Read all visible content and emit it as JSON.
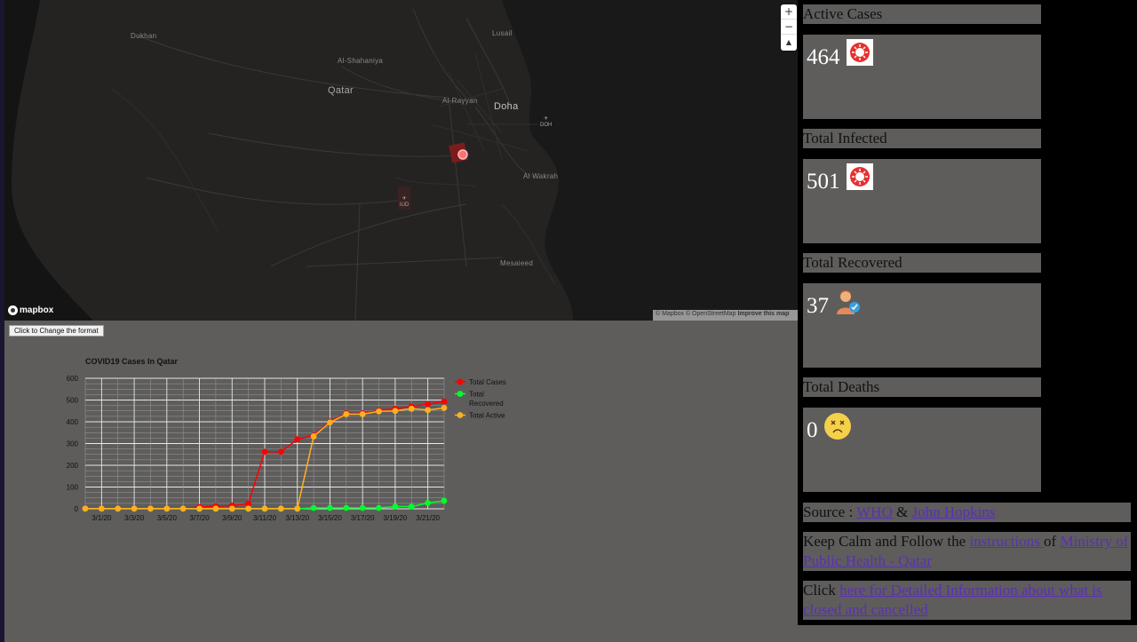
{
  "map": {
    "labels": {
      "dukhan": "Dukhan",
      "lusail": "Lusail",
      "al_shahaniya": "Al-Shahaniya",
      "qatar": "Qatar",
      "al_rayyan": "Al-Rayyan",
      "doha": "Doha",
      "doh": "DOH",
      "iud": "IUD",
      "al_wakrah": "Al Wakrah",
      "mesaieed": "Mesaieed"
    },
    "zoom_in": "+",
    "zoom_out": "−",
    "compass": "▲",
    "logo": "mapbox",
    "attribution": "© Mapbox © OpenStreetMap",
    "improve": "Improve this map"
  },
  "format_button": "Click to Change the format",
  "chart_data": {
    "type": "line",
    "title": "COVID19 Cases In Qatar",
    "x": [
      "2/29/20",
      "3/1/20",
      "3/2/20",
      "3/3/20",
      "3/4/20",
      "3/5/20",
      "3/6/20",
      "3/7/20",
      "3/8/20",
      "3/9/20",
      "3/10/20",
      "3/11/20",
      "3/12/20",
      "3/13/20",
      "3/14/20",
      "3/15/20",
      "3/16/20",
      "3/17/20",
      "3/18/20",
      "3/19/20",
      "3/20/20",
      "3/21/20",
      "3/22/20"
    ],
    "tick_labels": [
      "3/1/20",
      "3/3/20",
      "3/5/20",
      "3/7/20",
      "3/9/20",
      "3/11/20",
      "3/13/20",
      "3/15/20",
      "3/17/20",
      "3/19/20",
      "3/21/20"
    ],
    "ylim": [
      0,
      600
    ],
    "yticks": [
      "0",
      "100",
      "200",
      "300",
      "400",
      "500",
      "600"
    ],
    "grid": true,
    "legend_position": "right",
    "series": [
      {
        "name": "Total Cases",
        "color": "#ff0000",
        "values": [
          1,
          1,
          1,
          1,
          1,
          1,
          1,
          8,
          12,
          15,
          24,
          262,
          262,
          320,
          337,
          401,
          439,
          439,
          452,
          460,
          470,
          481,
          494
        ]
      },
      {
        "name": "Total Recovered",
        "color": "#00ff2a",
        "values": [
          0,
          0,
          0,
          0,
          0,
          0,
          0,
          0,
          0,
          0,
          0,
          0,
          0,
          0,
          4,
          4,
          4,
          4,
          4,
          10,
          10,
          27,
          37
        ]
      },
      {
        "name": "Total Active",
        "color": "#ffb020",
        "values": [
          1,
          1,
          1,
          1,
          1,
          1,
          1,
          1,
          1,
          1,
          1,
          1,
          1,
          1,
          333,
          397,
          435,
          435,
          448,
          450,
          460,
          454,
          464
        ]
      }
    ],
    "legend_labels": [
      {
        "name": "Total Cases",
        "lines": [
          "Total Cases"
        ],
        "color": "#ff0000"
      },
      {
        "name": "Total Recovered",
        "lines": [
          "Total",
          "Recovered"
        ],
        "color": "#00ff2a"
      },
      {
        "name": "Total Active",
        "lines": [
          "Total Active"
        ],
        "color": "#ffb020"
      }
    ]
  },
  "panels": {
    "active": {
      "title": "Active Cases",
      "value": "464",
      "icon": "virus-icon"
    },
    "infected": {
      "title": "Total Infected",
      "value": "501",
      "icon": "virus-icon"
    },
    "recovered": {
      "title": "Total Recovered",
      "value": "37",
      "icon": "recovered-person-icon"
    },
    "deaths": {
      "title": "Total Deaths",
      "value": "0",
      "icon": "dizzy-face-icon"
    }
  },
  "source": {
    "prefix": "Source : ",
    "who": "WHO",
    "amp": " & ",
    "jh": "John Hopkins"
  },
  "calm": {
    "prefix": "Keep Calm and Follow the ",
    "link1": "instructions ",
    "mid": "of ",
    "link2": "Ministry of Public Health - Qatar"
  },
  "click": {
    "prefix": "Click ",
    "link": "here for Detailed Information about what is closed and cancelled"
  },
  "colors": {
    "background": "#5e5d5c",
    "sidebar": "#000000",
    "link": "#5b2fb6",
    "map": "#242322"
  }
}
